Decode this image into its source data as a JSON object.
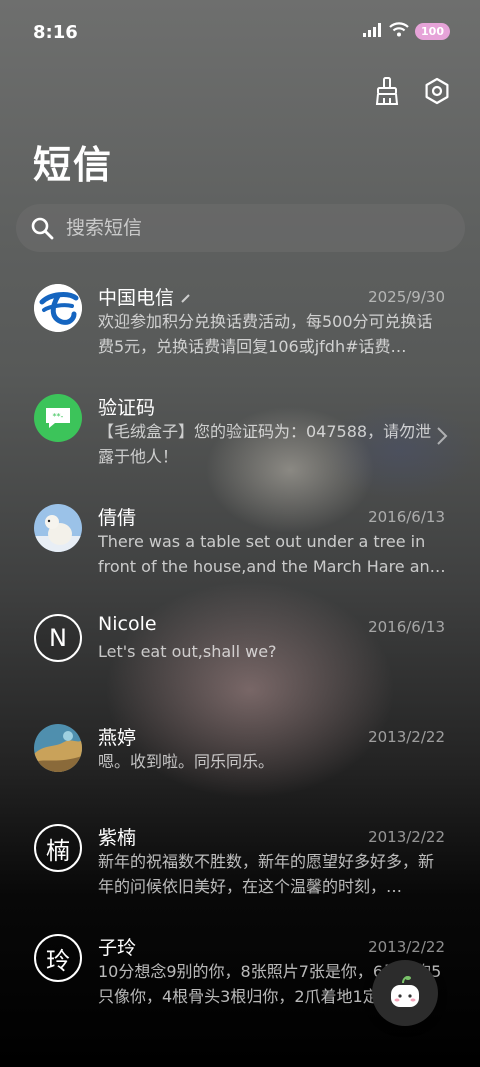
{
  "status": {
    "time": "8:16",
    "battery": "100"
  },
  "page": {
    "title": "短信"
  },
  "search": {
    "placeholder": "搜索短信"
  },
  "messages": [
    {
      "name": "中国电信",
      "date": "2025/9/30",
      "preview": "欢迎参加积分兑换话费活动，每500分可兑换话费5元，兑换话费请回复106或jfdh#话费…",
      "avatar": "china-telecom-logo"
    },
    {
      "name": "验证码",
      "date": "",
      "preview": "【毛绒盒子】您的验证码为：047588，请勿泄露于他人！",
      "avatar": "message-bubble"
    },
    {
      "name": "倩倩",
      "date": "2016/6/13",
      "preview": "There was a table set out under a tree in front of the house,and the March Hare an…",
      "avatar": "polar-bear-photo"
    },
    {
      "name": "Nicole",
      "date": "2016/6/13",
      "preview": "Let's eat out,shall we?",
      "avatar_letter": "N"
    },
    {
      "name": "燕婷",
      "date": "2013/2/22",
      "preview": "嗯。收到啦。同乐同乐。",
      "avatar": "landscape-photo"
    },
    {
      "name": "紫楠",
      "date": "2013/2/22",
      "preview": "新年的祝福数不胜数，新年的愿望好多好多，新年的问候依旧美好，在这个温馨的时刻，…",
      "avatar_letter": "楠"
    },
    {
      "name": "子玲",
      "date": "2013/2/22",
      "preview": "10分想念9别的你，8张照片7张是你，6只小狗5只像你，4根骨头3根归你，2爪着地1定…",
      "avatar_letter": "玲"
    }
  ],
  "colors": {
    "telecom_blue": "#1565c0",
    "verify_green": "#3cc45a"
  }
}
